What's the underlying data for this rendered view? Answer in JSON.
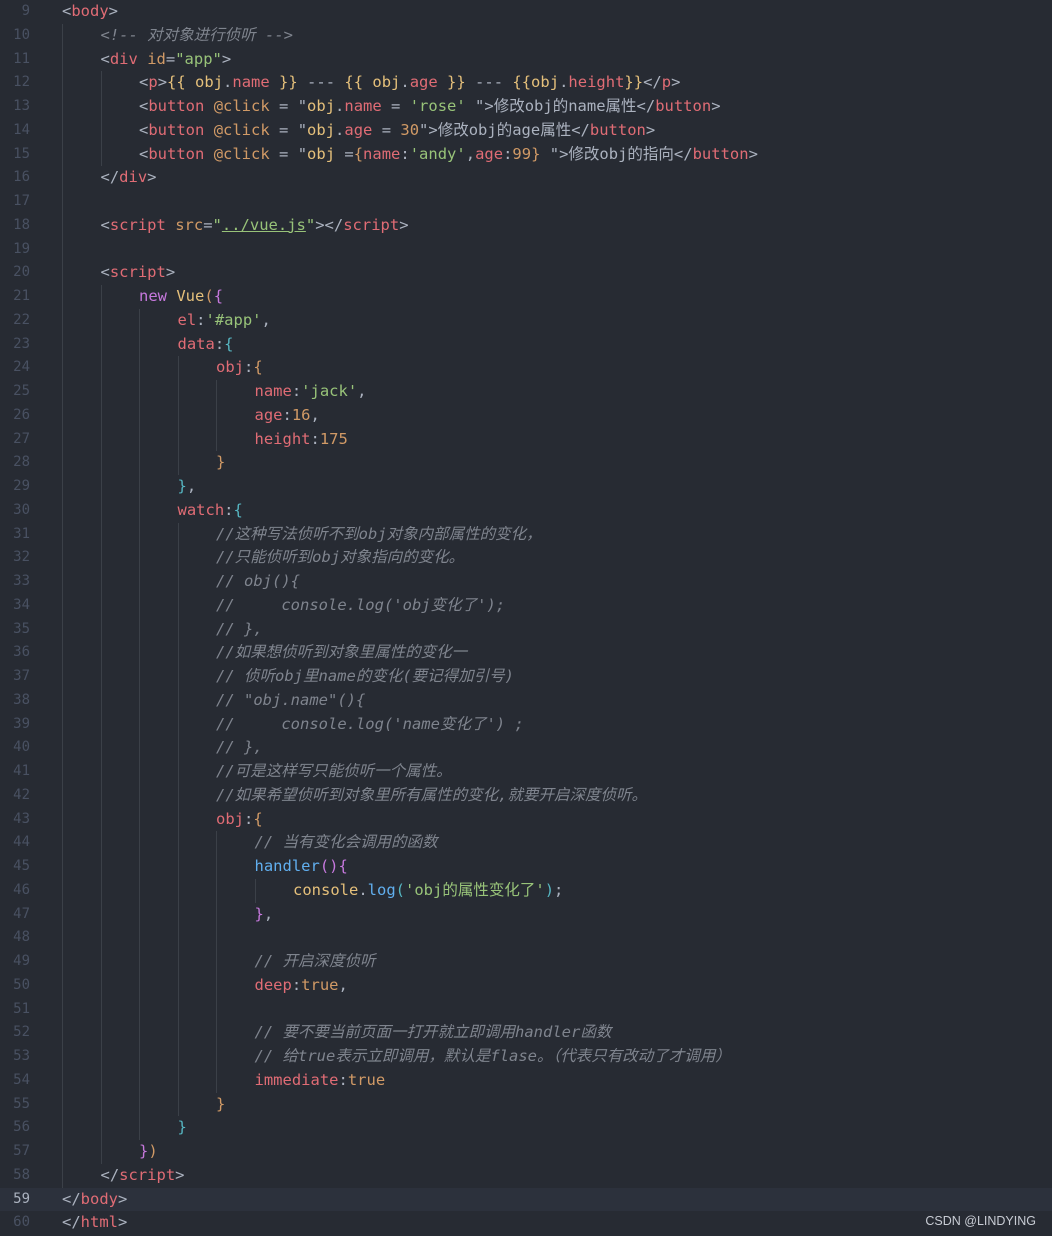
{
  "editor": {
    "watermark": "CSDN @LINDYING",
    "active_line": 59,
    "lines": [
      {
        "n": "9",
        "indent": 0,
        "tokens": [
          [
            "t-punc",
            "<"
          ],
          [
            "t-tag",
            "body"
          ],
          [
            "t-punc",
            ">"
          ]
        ]
      },
      {
        "n": "10",
        "indent": 1,
        "tokens": [
          [
            "t-com",
            "<!-- 对对象进行侦听 -->"
          ]
        ]
      },
      {
        "n": "11",
        "indent": 1,
        "tokens": [
          [
            "t-punc",
            "<"
          ],
          [
            "t-tag",
            "div"
          ],
          [
            "t-punc",
            " "
          ],
          [
            "t-attr",
            "id"
          ],
          [
            "t-punc",
            "="
          ],
          [
            "t-str",
            "\"app\""
          ],
          [
            "t-punc",
            ">"
          ]
        ]
      },
      {
        "n": "12",
        "indent": 2,
        "tokens": [
          [
            "t-punc",
            "<"
          ],
          [
            "t-tag",
            "p"
          ],
          [
            "t-punc",
            ">"
          ],
          [
            "t-prop",
            "{{ obj"
          ],
          [
            "t-punc",
            "."
          ],
          [
            "t-var",
            "name"
          ],
          [
            "t-prop",
            " }}"
          ],
          [
            "t-punc",
            " --- "
          ],
          [
            "t-prop",
            "{{ obj"
          ],
          [
            "t-punc",
            "."
          ],
          [
            "t-var",
            "age"
          ],
          [
            "t-prop",
            " }}"
          ],
          [
            "t-punc",
            " --- "
          ],
          [
            "t-prop",
            "{{obj"
          ],
          [
            "t-punc",
            "."
          ],
          [
            "t-var",
            "height"
          ],
          [
            "t-prop",
            "}}"
          ],
          [
            "t-punc",
            "</"
          ],
          [
            "t-tag",
            "p"
          ],
          [
            "t-punc",
            ">"
          ]
        ]
      },
      {
        "n": "13",
        "indent": 2,
        "tokens": [
          [
            "t-punc",
            "<"
          ],
          [
            "t-tag",
            "button"
          ],
          [
            "t-punc",
            " "
          ],
          [
            "t-attr",
            "@click"
          ],
          [
            "t-punc",
            " = "
          ],
          [
            "t-punc",
            "\""
          ],
          [
            "t-prop",
            "obj"
          ],
          [
            "t-punc",
            "."
          ],
          [
            "t-var",
            "name"
          ],
          [
            "t-punc",
            " = "
          ],
          [
            "t-str",
            "'rose'"
          ],
          [
            "t-punc",
            " \">修改obj的name属性</"
          ],
          [
            "t-tag",
            "button"
          ],
          [
            "t-punc",
            ">"
          ]
        ]
      },
      {
        "n": "14",
        "indent": 2,
        "tokens": [
          [
            "t-punc",
            "<"
          ],
          [
            "t-tag",
            "button"
          ],
          [
            "t-punc",
            " "
          ],
          [
            "t-attr",
            "@click"
          ],
          [
            "t-punc",
            " = "
          ],
          [
            "t-punc",
            "\""
          ],
          [
            "t-prop",
            "obj"
          ],
          [
            "t-punc",
            "."
          ],
          [
            "t-var",
            "age"
          ],
          [
            "t-punc",
            " = "
          ],
          [
            "t-num",
            "30"
          ],
          [
            "t-punc",
            "\">修改obj的age属性</"
          ],
          [
            "t-tag",
            "button"
          ],
          [
            "t-punc",
            ">"
          ]
        ]
      },
      {
        "n": "15",
        "indent": 2,
        "tokens": [
          [
            "t-punc",
            "<"
          ],
          [
            "t-tag",
            "button"
          ],
          [
            "t-punc",
            " "
          ],
          [
            "t-attr",
            "@click"
          ],
          [
            "t-punc",
            " = "
          ],
          [
            "t-punc",
            "\""
          ],
          [
            "t-prop",
            "obj"
          ],
          [
            "t-punc",
            " ="
          ],
          [
            "t-br1",
            "{"
          ],
          [
            "t-var",
            "name"
          ],
          [
            "t-punc",
            ":"
          ],
          [
            "t-str",
            "'andy'"
          ],
          [
            "t-punc",
            ","
          ],
          [
            "t-var",
            "age"
          ],
          [
            "t-punc",
            ":"
          ],
          [
            "t-num",
            "99"
          ],
          [
            "t-br1",
            "}"
          ],
          [
            "t-punc",
            " \">修改obj的指向</"
          ],
          [
            "t-tag",
            "button"
          ],
          [
            "t-punc",
            ">"
          ]
        ]
      },
      {
        "n": "16",
        "indent": 1,
        "tokens": [
          [
            "t-punc",
            "</"
          ],
          [
            "t-tag",
            "div"
          ],
          [
            "t-punc",
            ">"
          ]
        ]
      },
      {
        "n": "17",
        "indent": 1,
        "tokens": []
      },
      {
        "n": "18",
        "indent": 1,
        "tokens": [
          [
            "t-punc",
            "<"
          ],
          [
            "t-tag",
            "script"
          ],
          [
            "t-punc",
            " "
          ],
          [
            "t-attr",
            "src"
          ],
          [
            "t-punc",
            "="
          ],
          [
            "t-str",
            "\""
          ],
          [
            "t-link",
            "../vue.js"
          ],
          [
            "t-str",
            "\""
          ],
          [
            "t-punc",
            "></"
          ],
          [
            "t-tag",
            "script"
          ],
          [
            "t-punc",
            ">"
          ]
        ]
      },
      {
        "n": "19",
        "indent": 1,
        "tokens": []
      },
      {
        "n": "20",
        "indent": 1,
        "tokens": [
          [
            "t-punc",
            "<"
          ],
          [
            "t-tag",
            "script"
          ],
          [
            "t-punc",
            ">"
          ]
        ]
      },
      {
        "n": "21",
        "indent": 2,
        "tokens": [
          [
            "t-kw",
            "new"
          ],
          [
            "t-punc",
            " "
          ],
          [
            "t-cls",
            "Vue"
          ],
          [
            "t-br1",
            "("
          ],
          [
            "t-br2",
            "{"
          ]
        ]
      },
      {
        "n": "22",
        "indent": 3,
        "tokens": [
          [
            "t-var",
            "el"
          ],
          [
            "t-punc",
            ":"
          ],
          [
            "t-str",
            "'#app'"
          ],
          [
            "t-punc",
            ","
          ]
        ]
      },
      {
        "n": "23",
        "indent": 3,
        "tokens": [
          [
            "t-var",
            "data"
          ],
          [
            "t-punc",
            ":"
          ],
          [
            "t-br3",
            "{"
          ]
        ]
      },
      {
        "n": "24",
        "indent": 4,
        "tokens": [
          [
            "t-var",
            "obj"
          ],
          [
            "t-punc",
            ":"
          ],
          [
            "t-br1",
            "{"
          ]
        ]
      },
      {
        "n": "25",
        "indent": 5,
        "tokens": [
          [
            "t-var",
            "name"
          ],
          [
            "t-punc",
            ":"
          ],
          [
            "t-str",
            "'jack'"
          ],
          [
            "t-punc",
            ","
          ]
        ]
      },
      {
        "n": "26",
        "indent": 5,
        "tokens": [
          [
            "t-var",
            "age"
          ],
          [
            "t-punc",
            ":"
          ],
          [
            "t-num",
            "16"
          ],
          [
            "t-punc",
            ","
          ]
        ]
      },
      {
        "n": "27",
        "indent": 5,
        "tokens": [
          [
            "t-var",
            "height"
          ],
          [
            "t-punc",
            ":"
          ],
          [
            "t-num",
            "175"
          ]
        ]
      },
      {
        "n": "28",
        "indent": 4,
        "tokens": [
          [
            "t-br1",
            "}"
          ]
        ]
      },
      {
        "n": "29",
        "indent": 3,
        "tokens": [
          [
            "t-br3",
            "}"
          ],
          [
            "t-punc",
            ","
          ]
        ]
      },
      {
        "n": "30",
        "indent": 3,
        "tokens": [
          [
            "t-var",
            "watch"
          ],
          [
            "t-punc",
            ":"
          ],
          [
            "t-br3",
            "{"
          ]
        ]
      },
      {
        "n": "31",
        "indent": 4,
        "tokens": [
          [
            "t-com",
            "//这种写法侦听不到obj对象内部属性的变化，"
          ]
        ]
      },
      {
        "n": "32",
        "indent": 4,
        "tokens": [
          [
            "t-com",
            "//只能侦听到obj对象指向的变化。"
          ]
        ]
      },
      {
        "n": "33",
        "indent": 4,
        "tokens": [
          [
            "t-com",
            "// obj(){"
          ]
        ]
      },
      {
        "n": "34",
        "indent": 4,
        "tokens": [
          [
            "t-com",
            "//     console.log('obj变化了');"
          ]
        ]
      },
      {
        "n": "35",
        "indent": 4,
        "tokens": [
          [
            "t-com",
            "// },"
          ]
        ]
      },
      {
        "n": "36",
        "indent": 4,
        "tokens": [
          [
            "t-com",
            "//如果想侦听到对象里属性的变化一"
          ]
        ]
      },
      {
        "n": "37",
        "indent": 4,
        "tokens": [
          [
            "t-com",
            "// 侦听obj里name的变化(要记得加引号)"
          ]
        ]
      },
      {
        "n": "38",
        "indent": 4,
        "tokens": [
          [
            "t-com",
            "// \"obj.name\"(){"
          ]
        ]
      },
      {
        "n": "39",
        "indent": 4,
        "tokens": [
          [
            "t-com",
            "//     console.log('name变化了') ;"
          ]
        ]
      },
      {
        "n": "40",
        "indent": 4,
        "tokens": [
          [
            "t-com",
            "// },"
          ]
        ]
      },
      {
        "n": "41",
        "indent": 4,
        "tokens": [
          [
            "t-com",
            "//可是这样写只能侦听一个属性。"
          ]
        ]
      },
      {
        "n": "42",
        "indent": 4,
        "tokens": [
          [
            "t-com",
            "//如果希望侦听到对象里所有属性的变化,就要开启深度侦听。"
          ]
        ]
      },
      {
        "n": "43",
        "indent": 4,
        "tokens": [
          [
            "t-var",
            "obj"
          ],
          [
            "t-punc",
            ":"
          ],
          [
            "t-br1",
            "{"
          ]
        ]
      },
      {
        "n": "44",
        "indent": 5,
        "tokens": [
          [
            "t-com",
            "// 当有变化会调用的函数"
          ]
        ]
      },
      {
        "n": "45",
        "indent": 5,
        "tokens": [
          [
            "t-fn",
            "handler"
          ],
          [
            "t-br2",
            "()"
          ],
          [
            "t-br2",
            "{"
          ]
        ]
      },
      {
        "n": "46",
        "indent": 6,
        "tokens": [
          [
            "t-prop",
            "console"
          ],
          [
            "t-punc",
            "."
          ],
          [
            "t-fn",
            "log"
          ],
          [
            "t-br3",
            "("
          ],
          [
            "t-str",
            "'obj的属性变化了'"
          ],
          [
            "t-br3",
            ")"
          ],
          [
            "t-punc",
            ";"
          ]
        ]
      },
      {
        "n": "47",
        "indent": 5,
        "tokens": [
          [
            "t-br2",
            "}"
          ],
          [
            "t-punc",
            ","
          ]
        ]
      },
      {
        "n": "48",
        "indent": 5,
        "tokens": []
      },
      {
        "n": "49",
        "indent": 5,
        "tokens": [
          [
            "t-com",
            "// 开启深度侦听"
          ]
        ]
      },
      {
        "n": "50",
        "indent": 5,
        "tokens": [
          [
            "t-var",
            "deep"
          ],
          [
            "t-punc",
            ":"
          ],
          [
            "t-num",
            "true"
          ],
          [
            "t-punc",
            ","
          ]
        ]
      },
      {
        "n": "51",
        "indent": 5,
        "tokens": []
      },
      {
        "n": "52",
        "indent": 5,
        "tokens": [
          [
            "t-com",
            "// 要不要当前页面一打开就立即调用handler函数"
          ]
        ]
      },
      {
        "n": "53",
        "indent": 5,
        "tokens": [
          [
            "t-com",
            "// 给true表示立即调用，默认是flase。（代表只有改动了才调用）"
          ]
        ]
      },
      {
        "n": "54",
        "indent": 5,
        "tokens": [
          [
            "t-var",
            "immediate"
          ],
          [
            "t-punc",
            ":"
          ],
          [
            "t-num",
            "true"
          ]
        ]
      },
      {
        "n": "55",
        "indent": 4,
        "tokens": [
          [
            "t-br1",
            "}"
          ]
        ]
      },
      {
        "n": "56",
        "indent": 3,
        "tokens": [
          [
            "t-br3",
            "}"
          ]
        ]
      },
      {
        "n": "57",
        "indent": 2,
        "tokens": [
          [
            "t-br2",
            "}"
          ],
          [
            "t-br1",
            ")"
          ]
        ]
      },
      {
        "n": "58",
        "indent": 1,
        "tokens": [
          [
            "t-punc",
            "</"
          ],
          [
            "t-tag",
            "script"
          ],
          [
            "t-punc",
            ">"
          ]
        ]
      },
      {
        "n": "59",
        "indent": 0,
        "tokens": [
          [
            "t-punc",
            "</"
          ],
          [
            "t-tag",
            "body"
          ],
          [
            "t-punc",
            ">"
          ]
        ]
      },
      {
        "n": "60",
        "indent": 0,
        "tokens": [
          [
            "t-punc",
            "</"
          ],
          [
            "t-tag",
            "html"
          ],
          [
            "t-punc",
            ">"
          ]
        ]
      }
    ]
  }
}
